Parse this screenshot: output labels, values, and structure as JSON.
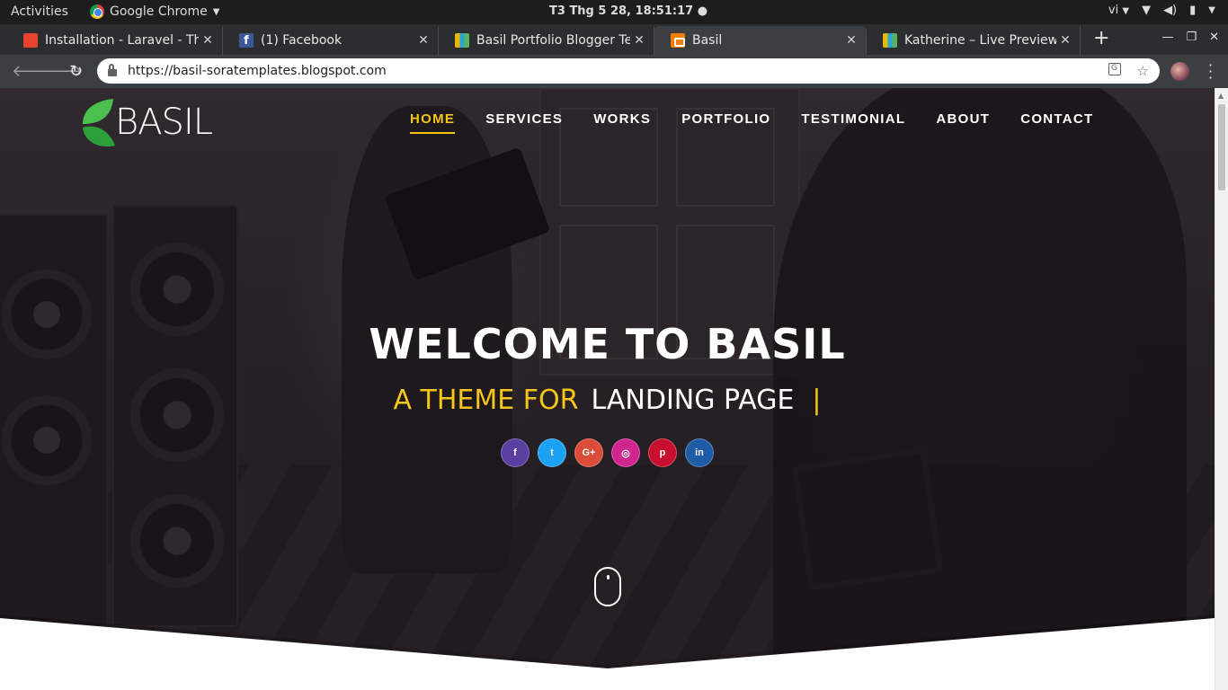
{
  "os": {
    "activities": "Activities",
    "app_name": "Google Chrome",
    "clock": "T3 Thg 5 28, 18:51:17",
    "lang": "vi"
  },
  "browser": {
    "tabs": [
      {
        "title": "Installation - Laravel - The",
        "favicon": "laravel-icon"
      },
      {
        "title": "(1) Facebook",
        "favicon": "facebook-icon"
      },
      {
        "title": "Basil Portfolio Blogger Te",
        "favicon": "soratemplates-icon"
      },
      {
        "title": "Basil",
        "favicon": "blogger-icon",
        "active": true
      },
      {
        "title": "Katherine – Live Preview",
        "favicon": "soratemplates-icon"
      }
    ],
    "url": "https://basil-soratemplates.blogspot.com"
  },
  "page": {
    "logo_text": "BASIL",
    "nav": [
      "HOME",
      "SERVICES",
      "WORKS",
      "PORTFOLIO",
      "TESTIMONIAL",
      "ABOUT",
      "CONTACT"
    ],
    "active_nav": "HOME",
    "hero_title": "WELCOME TO BASIL",
    "hero_sub_highlight": "A THEME FOR",
    "hero_sub_rest": "LANDING PAGE",
    "hero_cursor": "|",
    "socials": [
      {
        "label": "f",
        "name": "facebook",
        "color": "#5a3fa0"
      },
      {
        "label": "t",
        "name": "twitter",
        "color": "#1da1f2"
      },
      {
        "label": "G+",
        "name": "google-plus",
        "color": "#dd4b39"
      },
      {
        "label": "◎",
        "name": "instagram",
        "color": "#d1258f"
      },
      {
        "label": "p",
        "name": "pinterest",
        "color": "#c8102e"
      },
      {
        "label": "in",
        "name": "linkedin",
        "color": "#1f5ca8"
      }
    ],
    "colors": {
      "accent": "#f5c518",
      "logo_green": "#3cb043"
    }
  }
}
